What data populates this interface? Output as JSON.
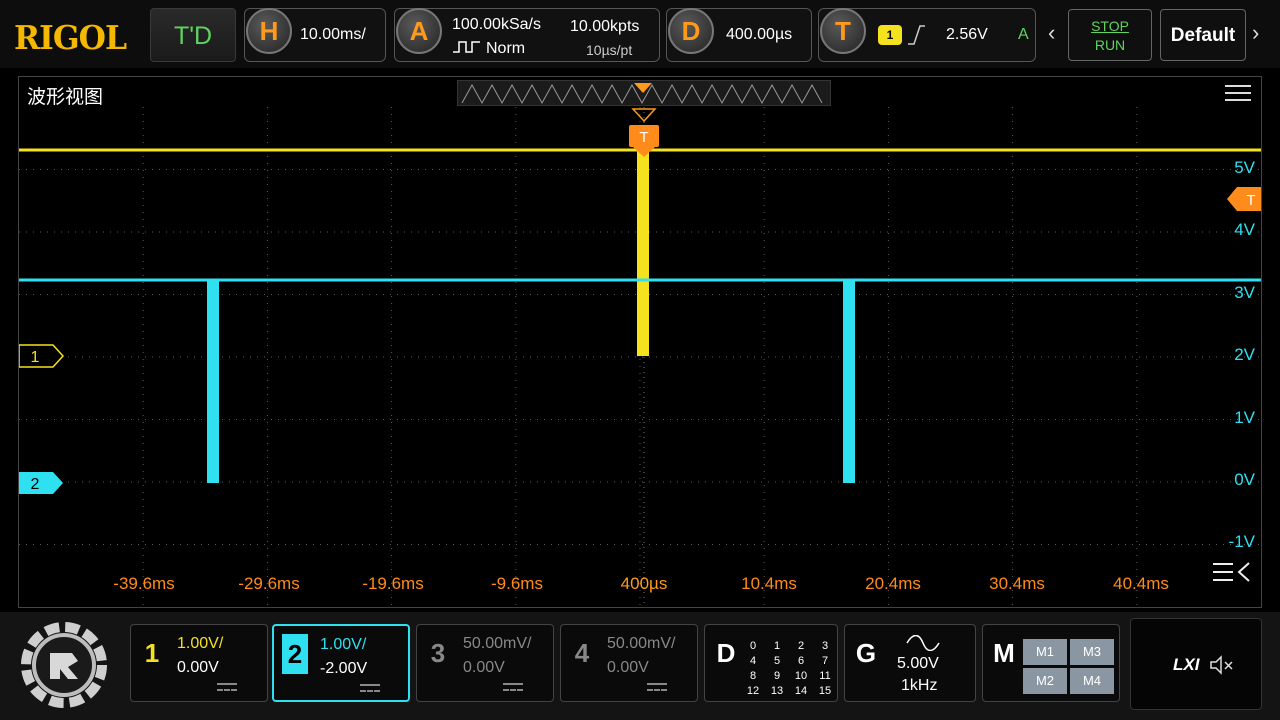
{
  "topbar": {
    "logo": "RIGOL",
    "mode": "T'D",
    "horizontal": {
      "key": "H",
      "timebase": "10.00ms/"
    },
    "acquire": {
      "key": "A",
      "sample_rate": "100.00kSa/s",
      "mem_depth": "10.00kpts",
      "acq_mode": "Norm",
      "pts_rate": "10µs/pt"
    },
    "delay": {
      "key": "D",
      "value": "400.00µs"
    },
    "trigger": {
      "key": "T",
      "source_chip": "1",
      "level": "2.56V",
      "sweep": "A"
    },
    "run_control": {
      "stop": "STOP",
      "run": "RUN"
    },
    "default_label": "Default",
    "prev_arrow": "‹",
    "next_arrow": "›"
  },
  "waveform_window": {
    "title": "波形视图",
    "trigger_marker": "T",
    "ch1_marker": "1",
    "ch2_marker": "2",
    "right_trigger_marker": "T",
    "y_labels": [
      "5V",
      "4V",
      "3V",
      "2V",
      "1V",
      "0V",
      "-1V"
    ],
    "x_labels": [
      "-39.6ms",
      "-29.6ms",
      "-19.6ms",
      "-9.6ms",
      "400µs",
      "10.4ms",
      "20.4ms",
      "30.4ms",
      "40.4ms"
    ]
  },
  "colors": {
    "ch1": "#f4e21e",
    "ch2": "#2ee0f0",
    "accent": "#ff9a1a",
    "axis_label": "#ff8c1a"
  },
  "channels": [
    {
      "num": "1",
      "scale": "1.00V/",
      "offset": "0.00V",
      "active": false,
      "color": "#f4e21e"
    },
    {
      "num": "2",
      "scale": "1.00V/",
      "offset": "-2.00V",
      "active": true,
      "color": "#2ee0f0"
    },
    {
      "num": "3",
      "scale": "50.00mV/",
      "offset": "0.00V",
      "active": false,
      "color": "#777777"
    },
    {
      "num": "4",
      "scale": "50.00mV/",
      "offset": "0.00V",
      "active": false,
      "color": "#777777"
    }
  ],
  "digital": {
    "key": "D",
    "rows": [
      [
        "0",
        "1",
        "2",
        "3"
      ],
      [
        "4",
        "5",
        "6",
        "7"
      ],
      [
        "8",
        "9",
        "10",
        "11"
      ],
      [
        "12",
        "13",
        "14",
        "15"
      ]
    ]
  },
  "generator": {
    "key": "G",
    "amplitude": "5.00V",
    "frequency": "1kHz"
  },
  "math": {
    "key": "M",
    "buttons": [
      "M1",
      "M3",
      "M2",
      "M4"
    ]
  },
  "status": {
    "lxi": "LXI",
    "mute_icon": "speaker-muted-icon"
  }
}
